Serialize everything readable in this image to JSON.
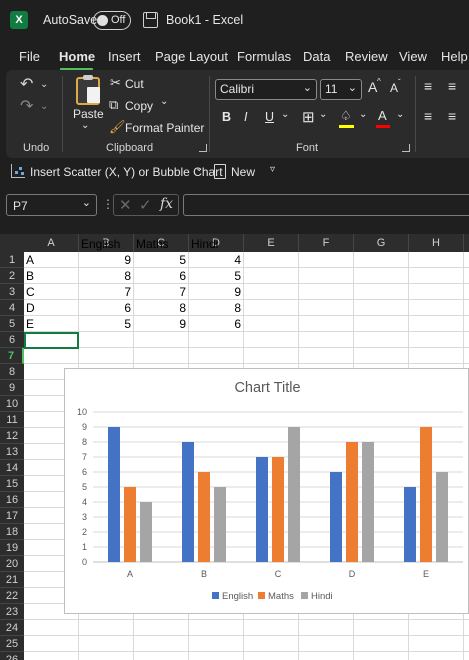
{
  "titlebar": {
    "logo": "X",
    "autosave_label": "AutoSave",
    "autosave_state": "Off",
    "doc_title": "Book1  -  Excel"
  },
  "menu": {
    "items": [
      "File",
      "Home",
      "Insert",
      "Page Layout",
      "Formulas",
      "Data",
      "Review",
      "View",
      "Help"
    ],
    "active": "Home"
  },
  "ribbon": {
    "undo_group": "Undo",
    "clipboard": {
      "paste": "Paste",
      "cut": "Cut",
      "copy": "Copy",
      "format_painter": "Format Painter",
      "group_label": "Clipboard"
    },
    "font": {
      "family": "Calibri",
      "size": "11",
      "grow_icon": "A",
      "shrink_icon": "A",
      "bold": "B",
      "italic": "I",
      "underline": "U",
      "font_color_icon": "A",
      "group_label": "Font",
      "highlight_color": "#ffff00",
      "font_color": "#ff0000"
    }
  },
  "qat": {
    "insert_scatter": "Insert Scatter (X, Y) or Bubble Chart",
    "new": "New"
  },
  "formula_bar": {
    "name_box": "P7",
    "fx": "fx",
    "formula": ""
  },
  "sheet": {
    "columns": [
      "A",
      "B",
      "C",
      "D",
      "E",
      "F",
      "G",
      "H"
    ],
    "rows": [
      "1",
      "2",
      "3",
      "4",
      "5",
      "6",
      "7",
      "8",
      "9",
      "10",
      "11",
      "12",
      "13",
      "14",
      "15",
      "16",
      "17",
      "18",
      "19",
      "20",
      "21",
      "22",
      "23",
      "24",
      "25",
      "26"
    ],
    "active_row": "7",
    "headers": [
      "",
      "English",
      "Maths",
      "Hindi"
    ],
    "data": [
      [
        "A",
        "9",
        "5",
        "4"
      ],
      [
        "B",
        "8",
        "6",
        "5"
      ],
      [
        "C",
        "7",
        "7",
        "9"
      ],
      [
        "D",
        "6",
        "8",
        "8"
      ],
      [
        "E",
        "5",
        "9",
        "6"
      ]
    ]
  },
  "chart_data": {
    "type": "bar",
    "title": "Chart Title",
    "categories": [
      "A",
      "B",
      "C",
      "D",
      "E"
    ],
    "series": [
      {
        "name": "English",
        "values": [
          9,
          8,
          7,
          6,
          5
        ],
        "color": "#4472c4"
      },
      {
        "name": "Maths",
        "values": [
          5,
          6,
          7,
          8,
          9
        ],
        "color": "#ed7d31"
      },
      {
        "name": "Hindi",
        "values": [
          4,
          5,
          9,
          8,
          6
        ],
        "color": "#a5a5a5"
      }
    ],
    "ylim": [
      0,
      10
    ],
    "yticks": [
      "0",
      "1",
      "2",
      "3",
      "4",
      "5",
      "6",
      "7",
      "8",
      "9",
      "10"
    ],
    "grid": true,
    "legend": "bottom"
  }
}
